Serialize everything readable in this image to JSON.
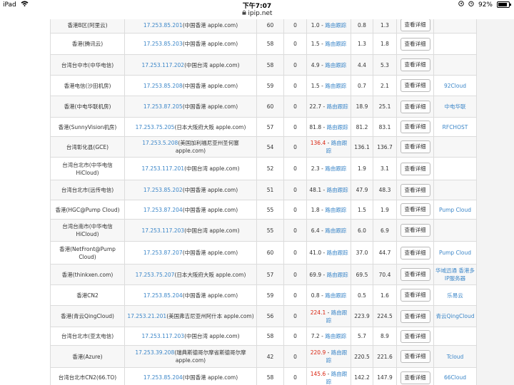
{
  "status": {
    "device": "iPad",
    "time": "下午7:07",
    "battery": "92%"
  },
  "url": "ipip.net",
  "detail_label": "查看详细",
  "traceroute_label": "路由跟踪",
  "rows": [
    {
      "node": "香港B区(阿里云)",
      "ip": "17.253.85.201",
      "loc": "(中国香港 apple.com)",
      "ttl": "60",
      "loss": "0",
      "ms": "1.0",
      "ms_red": false,
      "min": "0.8",
      "max": "1.3",
      "sponsor": "",
      "h": 22
    },
    {
      "node": "香港(腾讯云)",
      "ip": "17.253.85.203",
      "loc": "(中国香港 apple.com)",
      "ttl": "58",
      "loss": "0",
      "ms": "1.5",
      "ms_red": false,
      "min": "1.3",
      "max": "1.8",
      "sponsor": "",
      "h": 30
    },
    {
      "node": "台湾台中市(中华电信)",
      "ip": "17.253.117.202",
      "loc": "(中国台湾 apple.com)",
      "ttl": "58",
      "loss": "0",
      "ms": "4.9",
      "ms_red": false,
      "min": "4.4",
      "max": "5.3",
      "sponsor": "",
      "h": 29
    },
    {
      "node": "香港电信(沙田机房)",
      "ip": "17.253.85.208",
      "loc": "(中国香港 apple.com)",
      "ttl": "59",
      "loss": "0",
      "ms": "1.5",
      "ms_red": false,
      "min": "0.7",
      "max": "2.1",
      "sponsor": "92Cloud",
      "h": 29
    },
    {
      "node": "香港(中电华联机房)",
      "ip": "17.253.87.205",
      "loc": "(中国香港 apple.com)",
      "ttl": "60",
      "loss": "0",
      "ms": "22.7",
      "ms_red": false,
      "min": "18.9",
      "max": "25.1",
      "sponsor": "中电华联",
      "h": 30
    },
    {
      "node": "香港(SunnyVision机房)",
      "ip": "17.253.75.205",
      "loc": "(日本大阪府大阪 apple.com)",
      "ttl": "57",
      "loss": "0",
      "ms": "81.8",
      "ms_red": false,
      "min": "81.2",
      "max": "83.1",
      "sponsor": "RFCHOST",
      "h": 27
    },
    {
      "node": "台湾彰化县(GCE)",
      "ip": "17.253.5.208",
      "loc": "(美国加利福尼亚州圣何塞 apple.com)",
      "ttl": "54",
      "loss": "0",
      "ms": "136.4",
      "ms_red": true,
      "min": "136.1",
      "max": "136.7",
      "sponsor": "",
      "h": 29
    },
    {
      "node": "台湾台北市(中华电信HiCloud)",
      "ip": "17.253.117.201",
      "loc": "(中国台湾 apple.com)",
      "ttl": "52",
      "loss": "0",
      "ms": "2.3",
      "ms_red": false,
      "min": "1.9",
      "max": "3.1",
      "sponsor": "",
      "h": 32
    },
    {
      "node": "台湾台北市(远传电信)",
      "ip": "17.253.85.202",
      "loc": "(中国香港 apple.com)",
      "ttl": "51",
      "loss": "0",
      "ms": "48.1",
      "ms_red": false,
      "min": "47.9",
      "max": "48.3",
      "sponsor": "",
      "h": 28
    },
    {
      "node": "香港(HGC@Pump Cloud)",
      "ip": "17.253.87.204",
      "loc": "(中国香港 apple.com)",
      "ttl": "55",
      "loss": "0",
      "ms": "1.8",
      "ms_red": false,
      "min": "1.5",
      "max": "1.9",
      "sponsor": "Pump Cloud",
      "h": 27
    },
    {
      "node": "台湾台南市(中华电信HiCloud)",
      "ip": "17.253.117.203",
      "loc": "(中国台湾 apple.com)",
      "ttl": "55",
      "loss": "0",
      "ms": "6.4",
      "ms_red": false,
      "min": "6.0",
      "max": "6.9",
      "sponsor": "",
      "h": 31
    },
    {
      "node": "香港(NetFront@Pump Cloud)",
      "ip": "17.253.87.207",
      "loc": "(中国香港 apple.com)",
      "ttl": "60",
      "loss": "0",
      "ms": "41.0",
      "ms_red": false,
      "min": "37.0",
      "max": "44.7",
      "sponsor": "Pump Cloud",
      "h": 32
    },
    {
      "node": "香港(thinkxen.com)",
      "ip": "17.253.75.207",
      "loc": "(日本大阪府大阪 apple.com)",
      "ttl": "57",
      "loss": "0",
      "ms": "69.9",
      "ms_red": false,
      "min": "69.5",
      "max": "70.4",
      "sponsor": "华域迅通 香港多IP服务器",
      "h": 29
    },
    {
      "node": "香港CN2",
      "ip": "17.253.85.204",
      "loc": "(中国香港 apple.com)",
      "ttl": "59",
      "loss": "0",
      "ms": "0.8",
      "ms_red": false,
      "min": "0.5",
      "max": "1.6",
      "sponsor": "乐易云",
      "h": 29
    },
    {
      "node": "香港(青云QingCloud)",
      "ip": "17.253.21.201",
      "loc": "(美国弗吉尼亚州阿什本 apple.com)",
      "ttl": "56",
      "loss": "0",
      "ms": "224.1",
      "ms_red": true,
      "min": "223.9",
      "max": "224.5",
      "sponsor": "青云QingCloud",
      "h": 30
    },
    {
      "node": "台湾台北市(亚太电信)",
      "ip": "17.253.117.203",
      "loc": "(中国台湾 apple.com)",
      "ttl": "58",
      "loss": "0",
      "ms": "7.2",
      "ms_red": false,
      "min": "5.7",
      "max": "8.9",
      "sponsor": "",
      "h": 26
    },
    {
      "node": "香港(Azure)",
      "ip": "17.253.39.208",
      "loc": "(瑞典斯德哥尔摩省斯德哥尔摩 apple.com)",
      "ttl": "42",
      "loss": "0",
      "ms": "220.9",
      "ms_red": true,
      "min": "220.5",
      "max": "221.6",
      "sponsor": "Tcloud",
      "h": 31
    },
    {
      "node": "台湾台北市CN2(66.TO)",
      "ip": "17.253.85.204",
      "loc": "(中国香港 apple.com)",
      "ttl": "58",
      "loss": "0",
      "ms": "145.6",
      "ms_red": true,
      "min": "142.2",
      "max": "147.9",
      "sponsor": "66Cloud",
      "h": 28
    }
  ]
}
